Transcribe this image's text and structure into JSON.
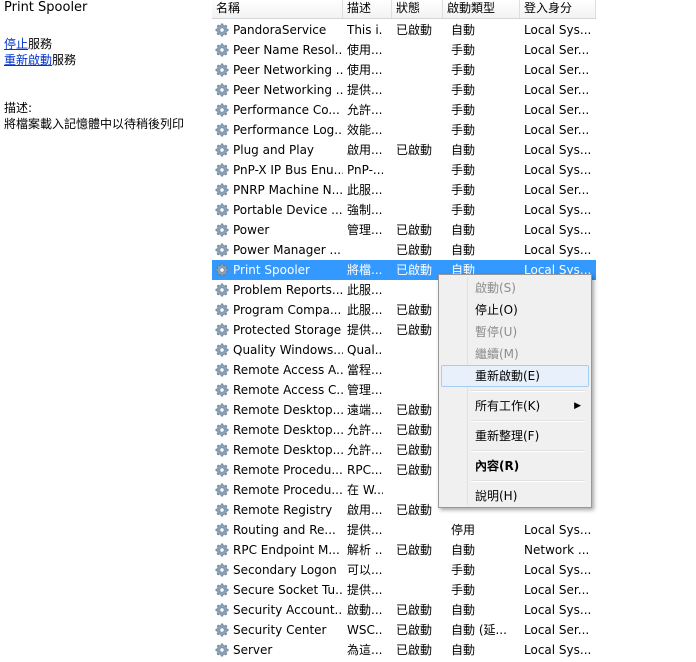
{
  "left_panel": {
    "service_title": "Print Spooler",
    "stop_link": "停止",
    "stop_suffix": "服務",
    "restart_link": "重新啟動",
    "restart_suffix": "服務",
    "desc_label": "描述:",
    "desc_text": "將檔案載入記憶體中以待稍後列印"
  },
  "table": {
    "headers": [
      "名稱",
      "描述",
      "狀態",
      "啟動類型",
      "登入身分"
    ],
    "rows": [
      [
        "PandoraService",
        "This i...",
        "已啟動",
        "自動",
        "Local Sys..."
      ],
      [
        "Peer Name Resol...",
        "使用...",
        "",
        "手動",
        "Local Ser..."
      ],
      [
        "Peer Networking ...",
        "使用...",
        "",
        "手動",
        "Local Ser..."
      ],
      [
        "Peer Networking ...",
        "提供...",
        "",
        "手動",
        "Local Ser..."
      ],
      [
        "Performance Co...",
        "允許...",
        "",
        "手動",
        "Local Ser..."
      ],
      [
        "Performance Log...",
        "效能...",
        "",
        "手動",
        "Local Ser..."
      ],
      [
        "Plug and Play",
        "啟用...",
        "已啟動",
        "自動",
        "Local Sys..."
      ],
      [
        "PnP-X IP Bus Enu...",
        "PnP-...",
        "",
        "手動",
        "Local Sys..."
      ],
      [
        "PNRP Machine N...",
        "此服...",
        "",
        "手動",
        "Local Ser..."
      ],
      [
        "Portable Device ...",
        "強制...",
        "",
        "手動",
        "Local Sys..."
      ],
      [
        "Power",
        "管理...",
        "已啟動",
        "自動",
        "Local Sys..."
      ],
      [
        "Power Manager ...",
        "",
        "已啟動",
        "自動",
        "Local Sys..."
      ],
      [
        "Print Spooler",
        "將檔...",
        "已啟動",
        "自動",
        "Local Sys..."
      ],
      [
        "Problem Reports...",
        "此服...",
        "",
        "",
        ""
      ],
      [
        "Program Compa...",
        "此服...",
        "已啟動",
        "",
        ""
      ],
      [
        "Protected Storage",
        "提供...",
        "已啟動",
        "",
        ""
      ],
      [
        "Quality Windows...",
        "Qual...",
        "",
        "",
        ""
      ],
      [
        "Remote Access A...",
        "當程...",
        "",
        "",
        ""
      ],
      [
        "Remote Access C...",
        "管理...",
        "",
        "",
        ""
      ],
      [
        "Remote Desktop...",
        "遠端...",
        "已啟動",
        "",
        ""
      ],
      [
        "Remote Desktop...",
        "允許...",
        "已啟動",
        "",
        ""
      ],
      [
        "Remote Desktop...",
        "允許...",
        "已啟動",
        "",
        ""
      ],
      [
        "Remote Procedu...",
        "RPC...",
        "已啟動",
        "",
        ""
      ],
      [
        "Remote Procedu...",
        "在 W...",
        "",
        "",
        ""
      ],
      [
        "Remote Registry",
        "啟用...",
        "已啟動",
        "",
        ""
      ],
      [
        "Routing and Re...",
        "提供...",
        "",
        "停用",
        "Local Sys..."
      ],
      [
        "RPC Endpoint M...",
        "解析 ...",
        "已啟動",
        "自動",
        "Network ..."
      ],
      [
        "Secondary Logon",
        "可以...",
        "",
        "手動",
        "Local Sys..."
      ],
      [
        "Secure Socket Tu...",
        "提供...",
        "",
        "手動",
        "Local Ser..."
      ],
      [
        "Security Account...",
        "啟動...",
        "已啟動",
        "自動",
        "Local Sys..."
      ],
      [
        "Security Center",
        "WSC...",
        "已啟動",
        "自動 (延...",
        "Local Ser..."
      ],
      [
        "Server",
        "為這...",
        "已啟動",
        "自動",
        "Local Sys..."
      ]
    ]
  },
  "context_menu": {
    "items": [
      {
        "label": "啟動(S)",
        "state": "disabled"
      },
      {
        "label": "停止(O)",
        "state": "enabled"
      },
      {
        "label": "暫停(U)",
        "state": "disabled"
      },
      {
        "label": "繼續(M)",
        "state": "disabled"
      },
      {
        "label": "重新啟動(E)",
        "state": "hover"
      },
      {
        "label": "所有工作(K)",
        "state": "submenu"
      },
      {
        "label": "重新整理(F)",
        "state": "enabled"
      },
      {
        "label": "內容(R)",
        "state": "bold"
      },
      {
        "label": "說明(H)",
        "state": "enabled"
      }
    ]
  },
  "colors": {
    "selection": "#3399ff",
    "link": "#0033cc",
    "menu_hover": "#e8f1fb"
  },
  "icons": {
    "service_row": "gear-icon",
    "submenu": "arrow-right-icon"
  }
}
